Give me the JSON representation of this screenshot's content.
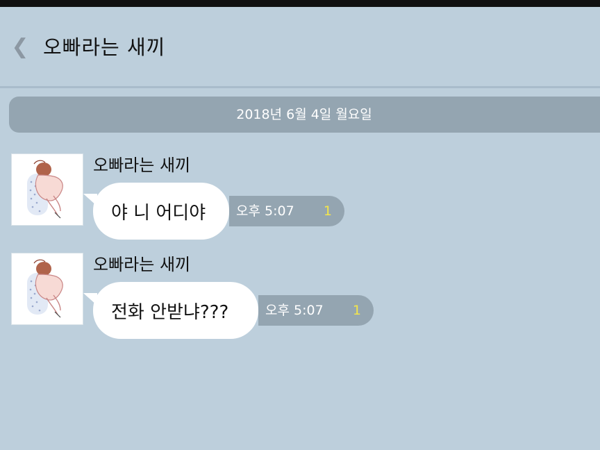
{
  "header": {
    "back_label": "❮",
    "title": "오빠라는 새끼"
  },
  "date_divider": {
    "text": "2018년 6월 4일 월요일"
  },
  "messages": [
    {
      "sender": "오빠라는 새끼",
      "text": "야 니 어디야",
      "time": "오후 5:07",
      "unread": "1"
    },
    {
      "sender": "오빠라는 새끼",
      "text": "전화 안받냐???",
      "time": "오후 5:07",
      "unread": "1"
    }
  ],
  "colors": {
    "background": "#bdcfdc",
    "date_bar": "#94a5b1",
    "bubble": "#ffffff",
    "unread": "#f4e64a"
  },
  "icons": {
    "back": "chevron-left-icon",
    "avatar": "profile-avatar-illustration"
  }
}
